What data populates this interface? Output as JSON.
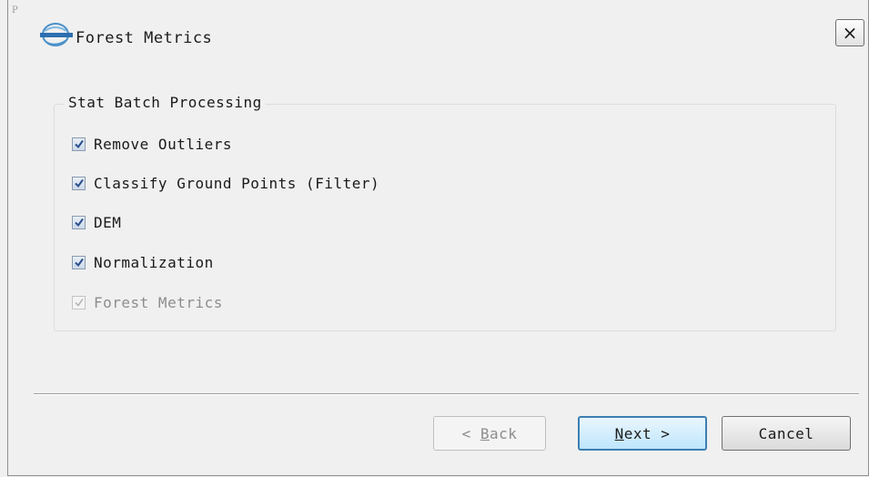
{
  "window": {
    "corner_mark": "P",
    "title": "Forest Metrics",
    "close_label": "×"
  },
  "group": {
    "label": "Stat Batch Processing",
    "options": [
      {
        "label": "Remove Outliers",
        "checked": true,
        "enabled": true
      },
      {
        "label": "Classify Ground Points (Filter)",
        "checked": true,
        "enabled": true
      },
      {
        "label": "DEM",
        "checked": true,
        "enabled": true
      },
      {
        "label": "Normalization",
        "checked": true,
        "enabled": true
      },
      {
        "label": "Forest Metrics",
        "checked": true,
        "enabled": false
      }
    ]
  },
  "buttons": {
    "back": {
      "prefix": "< ",
      "mnemonic": "B",
      "rest": "ack",
      "enabled": false
    },
    "next": {
      "mnemonic": "N",
      "rest": "ext >",
      "enabled": true
    },
    "cancel": {
      "label": "Cancel",
      "enabled": true
    }
  },
  "colors": {
    "check_mark": "#2a4f8f",
    "check_mark_disabled": "#b0b0b0",
    "default_button_border": "#3c7fb1"
  },
  "icons": {
    "app_logo": "lidar-logo-icon",
    "check": "check-icon",
    "close": "close-icon"
  }
}
